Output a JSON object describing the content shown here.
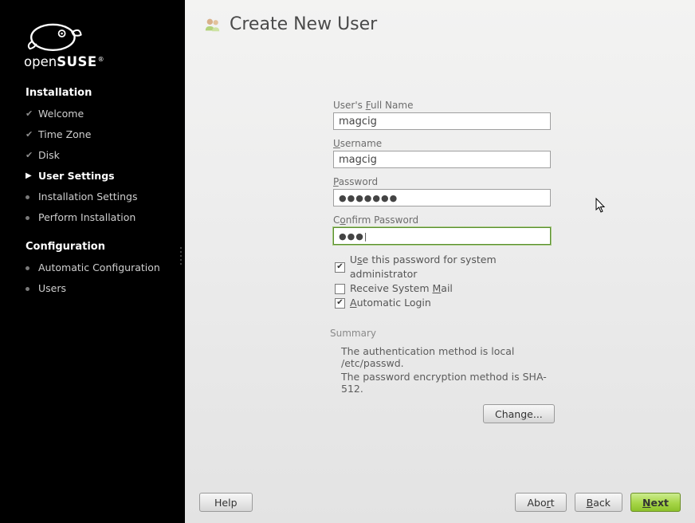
{
  "sidebar": {
    "brand_open": "open",
    "brand_suse": "SUSE",
    "section1_title": "Installation",
    "section2_title": "Configuration",
    "items1": [
      {
        "label": "Welcome",
        "state": "done"
      },
      {
        "label": "Time Zone",
        "state": "done"
      },
      {
        "label": "Disk",
        "state": "done"
      },
      {
        "label": "User Settings",
        "state": "current"
      },
      {
        "label": "Installation Settings",
        "state": "pending"
      },
      {
        "label": "Perform Installation",
        "state": "pending"
      }
    ],
    "items2": [
      {
        "label": "Automatic Configuration",
        "state": "pending"
      },
      {
        "label": "Users",
        "state": "pending"
      }
    ]
  },
  "page": {
    "title": "Create New User"
  },
  "form": {
    "fullname_label_pre": "User's ",
    "fullname_label_ul": "F",
    "fullname_label_post": "ull Name",
    "fullname_value": "magcig",
    "username_label_ul": "U",
    "username_label_post": "sername",
    "username_value": "magcig",
    "password_label_ul": "P",
    "password_label_post": "assword",
    "password_value": "●●●●●●●",
    "confirm_label_pre": "C",
    "confirm_label_ul": "o",
    "confirm_label_post": "nfirm Password",
    "confirm_value": "●●●|",
    "chk_sysadmin_pre": "U",
    "chk_sysadmin_ul": "s",
    "chk_sysadmin_post": "e this password for system administrator",
    "chk_sysadmin_checked": true,
    "chk_mail_pre": "Receive System ",
    "chk_mail_ul": "M",
    "chk_mail_post": "ail",
    "chk_mail_checked": false,
    "chk_autologin_ul": "A",
    "chk_autologin_post": "utomatic Login",
    "chk_autologin_checked": true
  },
  "summary": {
    "label": "Summary",
    "line1": "The authentication method is local /etc/passwd.",
    "line2": "The password encryption method is SHA-512.",
    "change_label": "Chan",
    "change_ul": "g",
    "change_post": "e..."
  },
  "footer": {
    "help": "Help",
    "abort_pre": "Abo",
    "abort_ul": "r",
    "abort_post": "t",
    "back_ul": "B",
    "back_post": "ack",
    "next_ul": "N",
    "next_post": "ext"
  }
}
